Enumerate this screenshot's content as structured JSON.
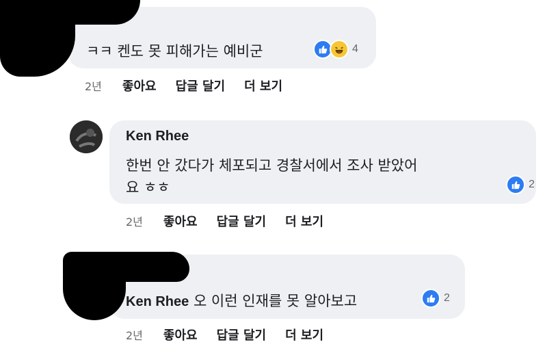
{
  "comments": [
    {
      "author": "",
      "text": "ㅋㅋ 켄도 못 피해가는 예비군",
      "reaction_count": "4",
      "reaction_icons": [
        "like-icon",
        "haha-icon"
      ],
      "time": "2년",
      "actions": [
        "좋아요",
        "답글 달기",
        "더 보기"
      ]
    },
    {
      "author": "Ken Rhee",
      "text_line1": "한번 안 갔다가 체포되고 경찰서에서 조사 받았어",
      "text_line2": "요 ㅎㅎ",
      "reaction_count": "2",
      "reaction_icons": [
        "like-icon"
      ],
      "time": "2년",
      "actions": [
        "좋아요",
        "답글 달기",
        "더 보기"
      ]
    },
    {
      "author": "Ken Rhee",
      "text": "오 이런 인재를 못 알아보고",
      "reaction_count": "2",
      "reaction_icons": [
        "like-icon"
      ],
      "time": "2년",
      "actions": [
        "좋아요",
        "답글 달기",
        "더 보기"
      ]
    }
  ],
  "colors": {
    "bubble": "#eef0f3",
    "like": "#2d7cf2",
    "haha": "#f7c633",
    "meta": "#65676b"
  }
}
